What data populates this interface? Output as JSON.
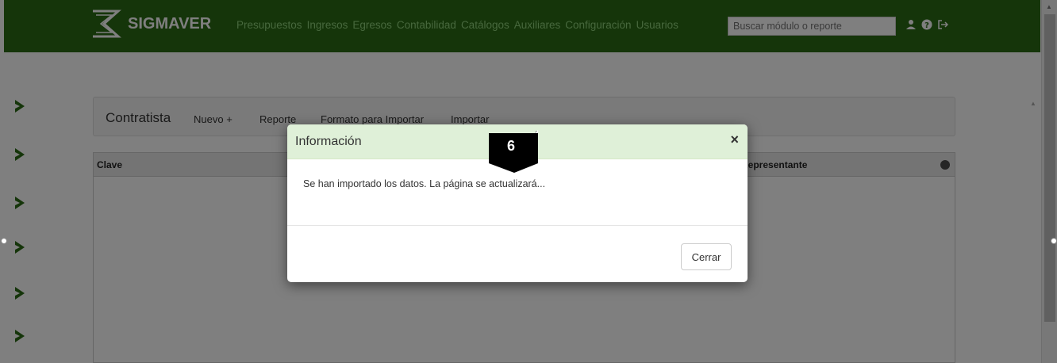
{
  "app": {
    "brand": "SIGMAVER"
  },
  "nav": {
    "items": [
      {
        "label": "Presupuestos"
      },
      {
        "label": "Ingresos"
      },
      {
        "label": "Egresos"
      },
      {
        "label": "Contabilidad"
      },
      {
        "label": "Catálogos"
      },
      {
        "label": "Auxiliares"
      },
      {
        "label": "Configuración"
      },
      {
        "label": "Usuarios"
      }
    ],
    "search_placeholder": "Buscar módulo o reporte",
    "icons": [
      "user-icon",
      "help-icon",
      "logout-icon"
    ]
  },
  "page": {
    "title": "Contratista",
    "actions": [
      {
        "label": "Nuevo +"
      },
      {
        "label": "Reporte"
      },
      {
        "label": "Formato para Importar"
      },
      {
        "label": "Importar"
      }
    ]
  },
  "grid": {
    "columns": [
      {
        "label": "Clave"
      },
      {
        "label": "Representante"
      }
    ]
  },
  "modal": {
    "title": "Información",
    "message": "Se han importado los datos. La página se actualizará...",
    "close_button": "Cerrar",
    "close_symbol": "×"
  },
  "step_badge": {
    "number": "6"
  },
  "colors": {
    "navbar": "#2b6b15",
    "nav_link": "#8ed07a",
    "modal_header": "#dff0d8"
  }
}
